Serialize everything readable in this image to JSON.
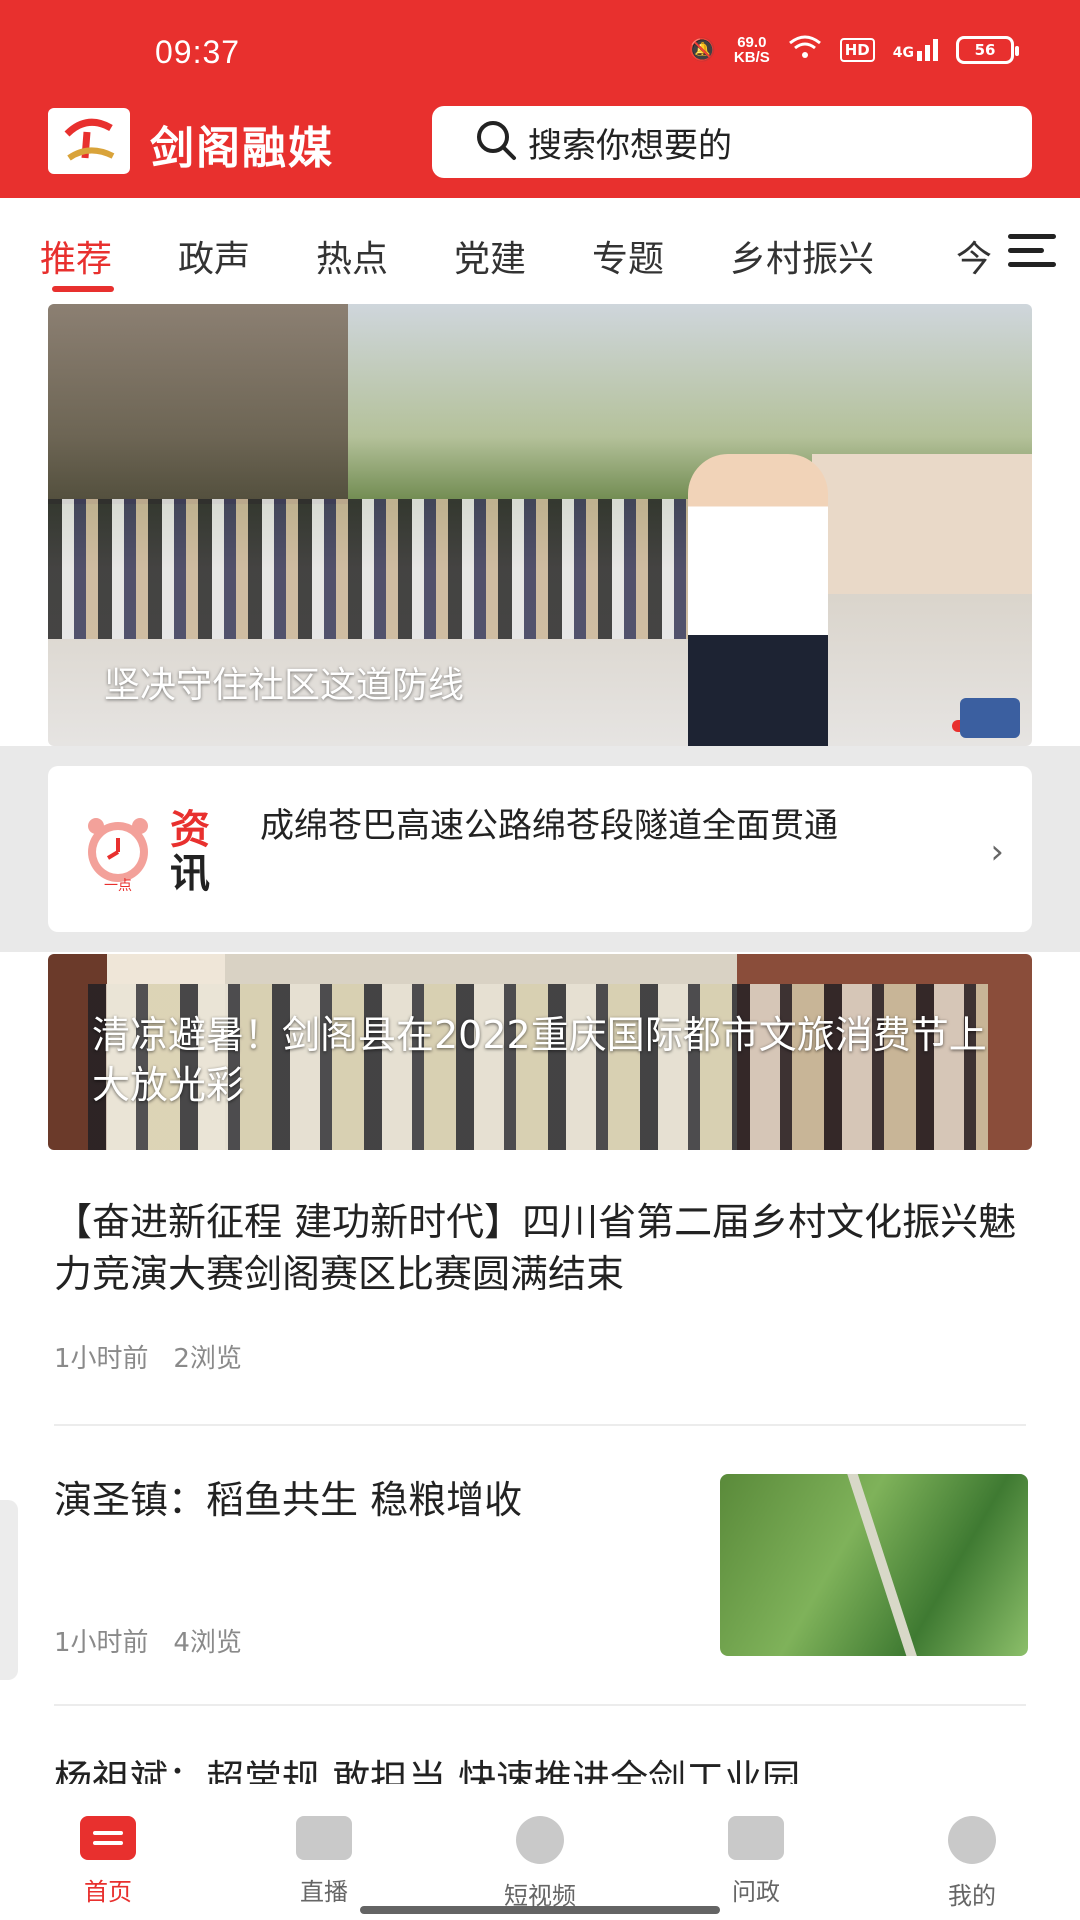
{
  "status": {
    "time": "09:37",
    "net_speed": "69.0",
    "net_unit": "KB/S",
    "hd": "HD",
    "signal": "4G",
    "battery": "56"
  },
  "header": {
    "app_name": "剑阁融媒",
    "search_placeholder": "搜索你想要的",
    "accent_color": "#e8302e"
  },
  "tabs": [
    "推荐",
    "政声",
    "热点",
    "党建",
    "专题",
    "乡村振兴",
    "今"
  ],
  "banner": {
    "caption": "坚决守住社区这道防线"
  },
  "flash": {
    "label_top": "资",
    "label_bottom": "讯",
    "clock_label": "一点",
    "text": "成绵苍巴高速公路绵苍段隧道全面贯通"
  },
  "banner2": {
    "caption": "清凉避暑！剑阁县在2022重庆国际都市文旅消费节上大放光彩"
  },
  "articles": [
    {
      "title": "【奋进新征程 建功新时代】四川省第二届乡村文化振兴魅力竞演大赛剑阁赛区比赛圆满结束",
      "time": "1小时前",
      "views": "2浏览"
    },
    {
      "title": "演圣镇：稻鱼共生 稳粮增收",
      "time": "1小时前",
      "views": "4浏览"
    },
    {
      "title": "杨祖斌：超常规 敢担当 快速推进全剑工业园"
    }
  ],
  "bottom_nav": [
    "首页",
    "直播",
    "短视频",
    "问政",
    "我的"
  ]
}
